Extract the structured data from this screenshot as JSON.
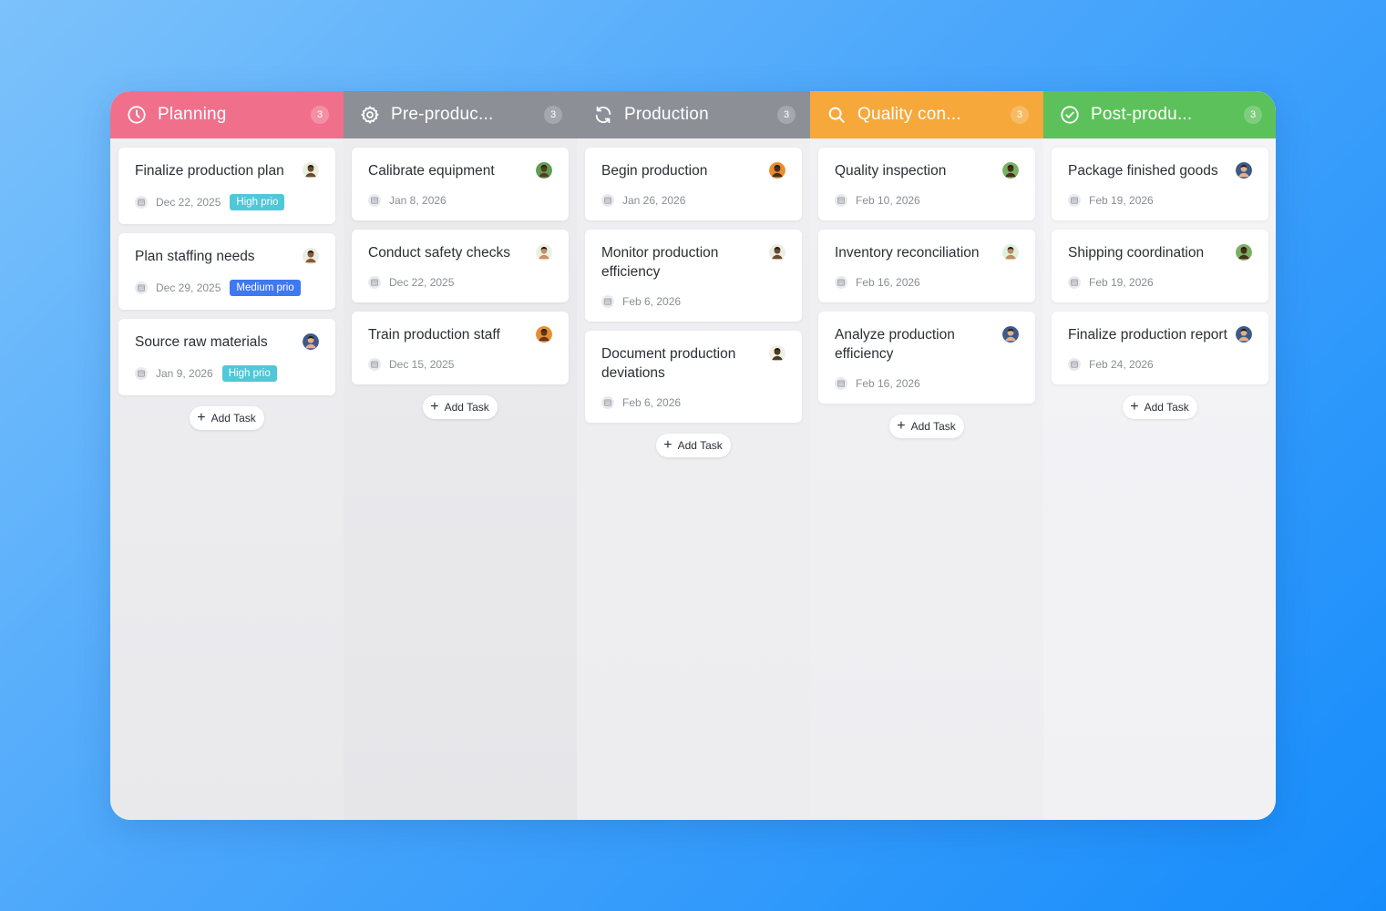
{
  "board": {
    "columns": [
      {
        "title": "Planning",
        "count": "3",
        "color": "#f0708c",
        "icon": "clock-icon",
        "add_label": "Add Task",
        "cards": [
          {
            "title": "Finalize production plan",
            "date": "Dec 22, 2025",
            "badge": "High prio",
            "badge_color": "#4fc8d8",
            "avatar_bg": "#e8efe0",
            "avatar_skin": "#6b4a2e",
            "avatar": "user-avatar"
          },
          {
            "title": "Plan staffing needs",
            "date": "Dec 29, 2025",
            "badge": "Medium prio",
            "badge_color": "#3f78f0",
            "avatar_bg": "#ebeee4",
            "avatar_skin": "#8a5a34",
            "avatar": "user-avatar"
          },
          {
            "title": "Source raw materials",
            "date": "Jan 9, 2026",
            "badge": "High prio",
            "badge_color": "#4fc8d8",
            "avatar_bg": "#3d5a88",
            "avatar_skin": "#e1b08c",
            "avatar": "user-avatar"
          }
        ]
      },
      {
        "title": "Pre-produc...",
        "count": "3",
        "color": "#8c8f96",
        "icon": "gear-icon",
        "add_label": "Add Task",
        "cards": [
          {
            "title": "Calibrate equipment",
            "date": "Jan 8, 2026",
            "badge": "",
            "badge_color": "",
            "avatar_bg": "#5e9e52",
            "avatar_skin": "#5a3a22",
            "avatar": "user-avatar"
          },
          {
            "title": "Conduct safety checks",
            "date": "Dec 22, 2025",
            "badge": "",
            "badge_color": "",
            "avatar_bg": "#e9f1e2",
            "avatar_skin": "#c98f66",
            "avatar": "user-avatar"
          },
          {
            "title": "Train production staff",
            "date": "Dec 15, 2025",
            "badge": "",
            "badge_color": "",
            "avatar_bg": "#e98d2e",
            "avatar_skin": "#5a3a22",
            "avatar": "user-avatar"
          }
        ]
      },
      {
        "title": "Production",
        "count": "3",
        "color": "#8c8f96",
        "icon": "refresh-icon",
        "add_label": "Add Task",
        "cards": [
          {
            "title": "Begin production",
            "date": "Jan 26, 2026",
            "badge": "",
            "badge_color": "",
            "avatar_bg": "#e98d2e",
            "avatar_skin": "#4a2e1c",
            "avatar": "user-avatar"
          },
          {
            "title": "Monitor production efficiency",
            "date": "Feb 6, 2026",
            "badge": "",
            "badge_color": "",
            "avatar_bg": "#ebeee4",
            "avatar_skin": "#6b4a2e",
            "avatar": "user-avatar"
          },
          {
            "title": "Document production deviations",
            "date": "Feb 6, 2026",
            "badge": "",
            "badge_color": "",
            "avatar_bg": "#eef0e4",
            "avatar_skin": "#4a3a22",
            "avatar": "user-avatar"
          }
        ]
      },
      {
        "title": "Quality con...",
        "count": "3",
        "color": "#f7a83a",
        "icon": "search-icon",
        "add_label": "Add Task",
        "cards": [
          {
            "title": "Quality inspection",
            "date": "Feb 10, 2026",
            "badge": "",
            "badge_color": "",
            "avatar_bg": "#7ab062",
            "avatar_skin": "#4a2e1c",
            "avatar": "user-avatar"
          },
          {
            "title": "Inventory reconciliation",
            "date": "Feb 16, 2026",
            "badge": "",
            "badge_color": "",
            "avatar_bg": "#dff0dc",
            "avatar_skin": "#c08a62",
            "avatar": "user-avatar"
          },
          {
            "title": "Analyze production efficiency",
            "date": "Feb 16, 2026",
            "badge": "",
            "badge_color": "",
            "avatar_bg": "#3d5a88",
            "avatar_skin": "#e1b08c",
            "avatar": "user-avatar"
          }
        ]
      },
      {
        "title": "Post-produ...",
        "count": "3",
        "color": "#5cc15a",
        "icon": "check-circle-icon",
        "add_label": "Add Task",
        "cards": [
          {
            "title": "Package finished goods",
            "date": "Feb 19, 2026",
            "badge": "",
            "badge_color": "",
            "avatar_bg": "#3d5a88",
            "avatar_skin": "#e1b08c",
            "avatar": "user-avatar"
          },
          {
            "title": "Shipping coordination",
            "date": "Feb 19, 2026",
            "badge": "",
            "badge_color": "",
            "avatar_bg": "#7ab062",
            "avatar_skin": "#4a2e1c",
            "avatar": "user-avatar"
          },
          {
            "title": "Finalize production report",
            "date": "Feb 24, 2026",
            "badge": "",
            "badge_color": "",
            "avatar_bg": "#3d5a88",
            "avatar_skin": "#e1b08c",
            "avatar": "user-avatar"
          }
        ]
      }
    ]
  }
}
